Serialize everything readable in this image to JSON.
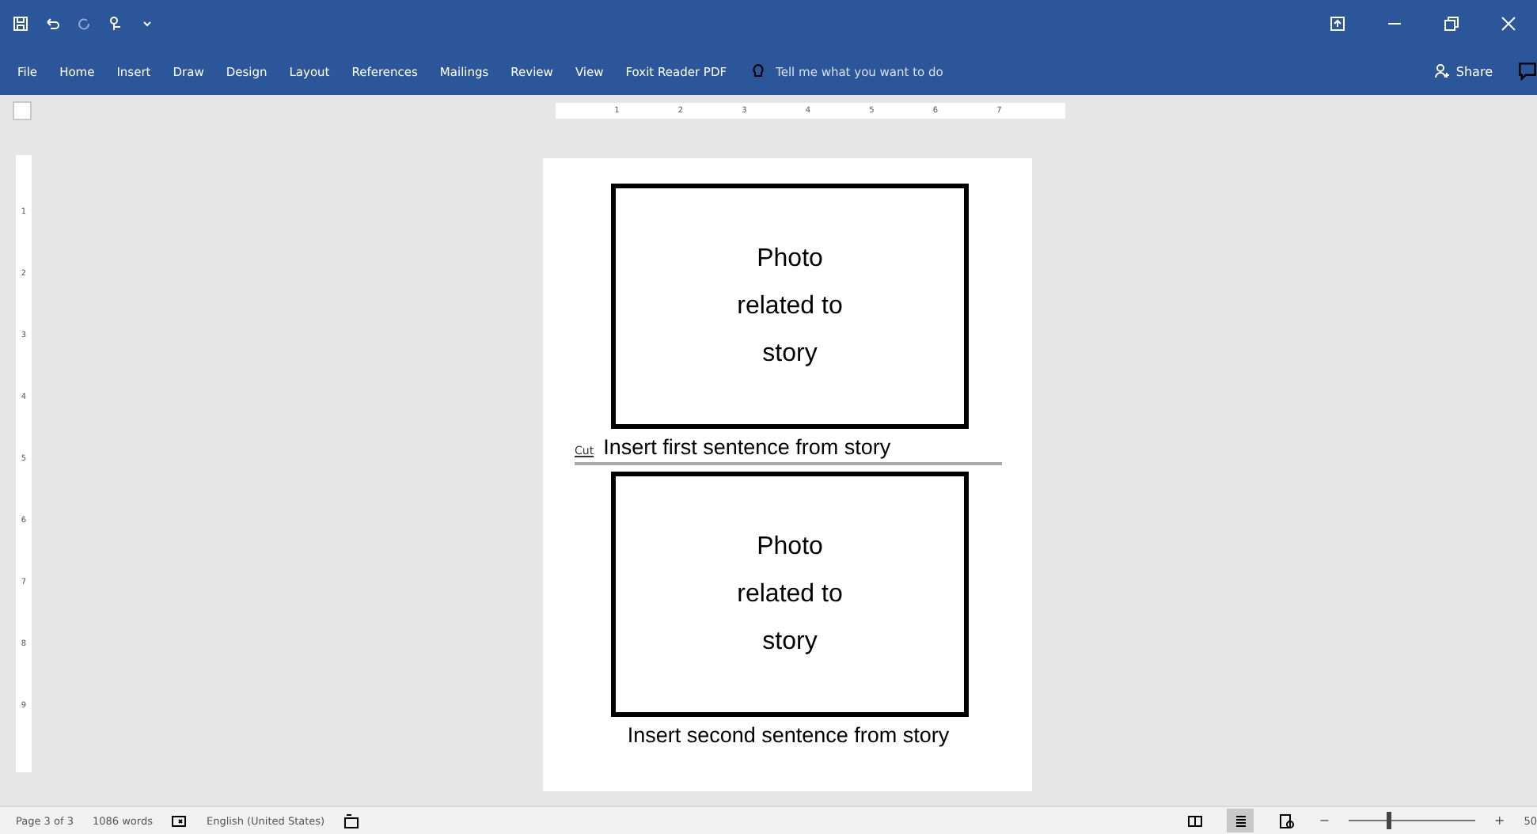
{
  "window": {
    "title_controls": [
      {
        "kind": "ribbon-display"
      },
      {
        "kind": "minimize"
      },
      {
        "kind": "restore"
      },
      {
        "kind": "close"
      }
    ]
  },
  "ribbon_tabs": [
    {
      "label": "File",
      "selected": false
    },
    {
      "label": "Home",
      "selected": false
    },
    {
      "label": "Insert",
      "selected": false
    },
    {
      "label": "Draw",
      "selected": false
    },
    {
      "label": "Design",
      "selected": false
    },
    {
      "label": "Layout",
      "selected": false
    },
    {
      "label": "References",
      "selected": false
    },
    {
      "label": "Mailings",
      "selected": false
    },
    {
      "label": "Review",
      "selected": false
    },
    {
      "label": "View",
      "selected": false
    },
    {
      "label": "Foxit Reader PDF",
      "selected": false
    }
  ],
  "tell_me": {
    "placeholder": "Tell me what you want to do"
  },
  "share": {
    "label": "Share"
  },
  "horizontal_ruler": [
    "1",
    "2",
    "3",
    "4",
    "5",
    "6",
    "7"
  ],
  "vertical_ruler": [
    "1",
    "2",
    "3",
    "4",
    "5",
    "6",
    "7",
    "8",
    "9"
  ],
  "document": {
    "blocks": [
      {
        "kind": "photo",
        "lines": [
          "Photo",
          "related to",
          "story"
        ]
      },
      {
        "kind": "caption",
        "tag": "Cut",
        "text": "Insert first sentence from story",
        "cut_line": true
      },
      {
        "kind": "photo",
        "lines": [
          "Photo",
          "related to",
          "story"
        ]
      },
      {
        "kind": "caption",
        "text": "Insert second sentence from story",
        "cut_line": false
      }
    ]
  },
  "status_bar": {
    "page": "Page 3 of 3",
    "words": "1086 words",
    "language": "English (United States)",
    "view_buttons": [
      {
        "kind": "read",
        "selected": false
      },
      {
        "kind": "print",
        "selected": true
      },
      {
        "kind": "web",
        "selected": false
      }
    ],
    "zoom_minus": "−",
    "zoom_plus": "+",
    "zoom": {
      "level": 0.3,
      "reading": "50"
    }
  }
}
